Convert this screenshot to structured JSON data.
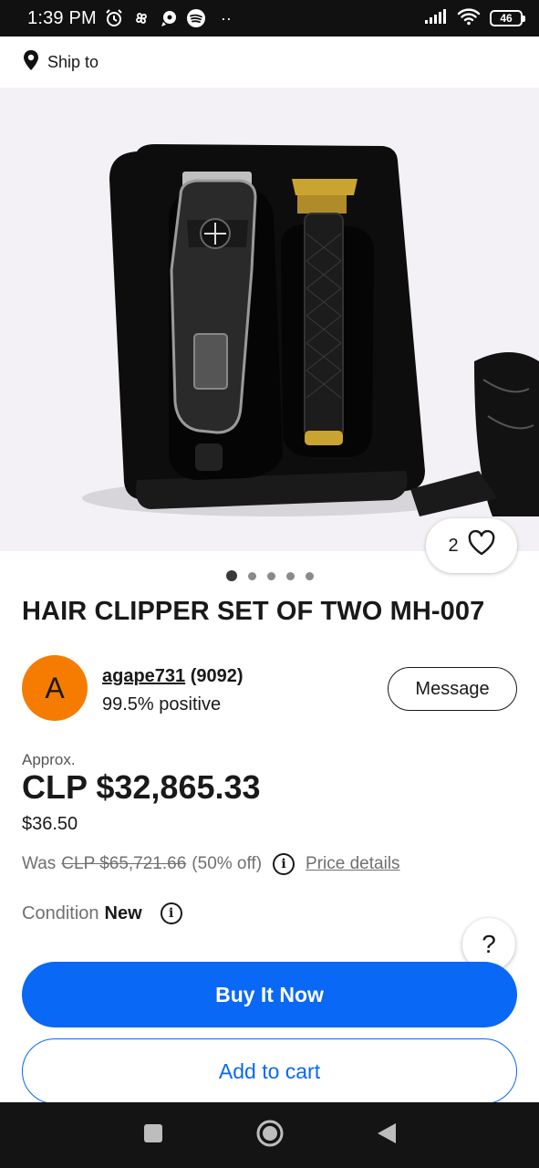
{
  "status_bar": {
    "time": "1:39 PM",
    "battery": "46",
    "more": "··"
  },
  "header": {
    "ship_to": "Ship to"
  },
  "gallery": {
    "favorites_count": "2",
    "image_count": 5,
    "active_index": 0
  },
  "product": {
    "title": "HAIR CLIPPER SET OF TWO MH-007"
  },
  "seller": {
    "avatar_letter": "A",
    "username": "agape731",
    "feedback_score": "(9092)",
    "positive": "99.5% positive",
    "message_label": "Message"
  },
  "pricing": {
    "approx_label": "Approx.",
    "price": "CLP $32,865.33",
    "usd_price": "$36.50",
    "was_label": "Was",
    "was_price": "CLP $65,721.66",
    "discount": "(50% off)",
    "details_link": "Price details"
  },
  "condition": {
    "label": "Condition",
    "value": "New"
  },
  "actions": {
    "help": "?",
    "buy_now": "Buy It Now",
    "add_to_cart": "Add to cart"
  },
  "colors": {
    "primary": "#0968f6",
    "avatar": "#f57c00"
  }
}
